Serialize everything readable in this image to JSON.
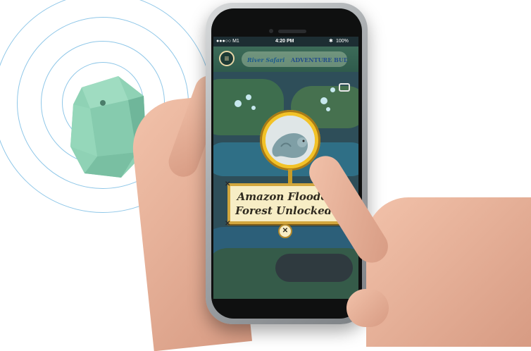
{
  "status_bar": {
    "carrier": "●●●○○ M1",
    "time": "4:20 PM",
    "battery": "100%"
  },
  "game": {
    "logo_left": "River Safari",
    "logo_right": "ADVENTURE BUDDY"
  },
  "popup": {
    "line1": "Amazon Flooded",
    "line2": "Forest Unlocked!",
    "close_label": "✕"
  },
  "icons": {
    "menu": "hamburger-menu-icon",
    "camera": "camera-icon",
    "beacon": "beacon-device-icon"
  },
  "colors": {
    "beacon_mint": "#8fd2b5",
    "ring_blue": "#8fc7e8",
    "banner_bg": "#f7edc5",
    "banner_border": "#d2a63d",
    "medallion": "#f2c227"
  }
}
